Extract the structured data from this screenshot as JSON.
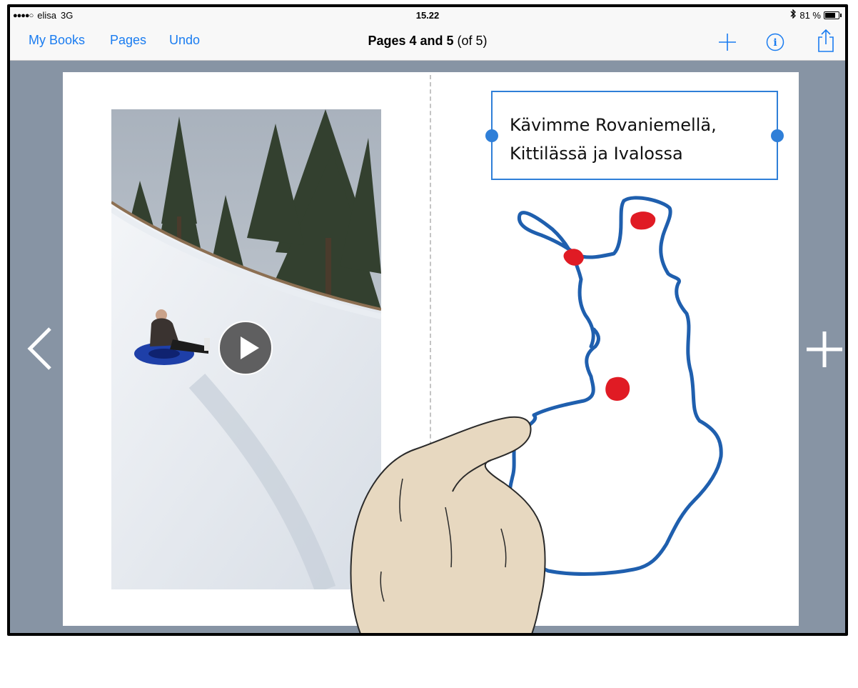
{
  "status": {
    "carrier": "elisa",
    "network": "3G",
    "time": "15.22",
    "battery": "81 %",
    "battery_level": 0.81,
    "signal_bars": "●●●●○"
  },
  "toolbar": {
    "my_books": "My Books",
    "pages": "Pages",
    "undo": "Undo",
    "title_main": "Pages 4 and 5",
    "title_sub": "(of 5)",
    "add_icon": "plus-icon",
    "info_icon": "info-icon",
    "share_icon": "share-icon"
  },
  "page": {
    "text_line_1": "Kävimme Rovaniemellä,",
    "text_line_2": "Kittilässä ja Ivalossa",
    "photo": "video of person sledding on snow tube",
    "map": "hand-drawn outline map with three red dots"
  },
  "nav": {
    "prev_icon": "chevron-left-icon",
    "next_icon": "plus-icon"
  },
  "colors": {
    "accent": "#1a7cf0",
    "map_line": "#1f5fae",
    "dot": "#e01b24",
    "background": "#8794a4"
  }
}
